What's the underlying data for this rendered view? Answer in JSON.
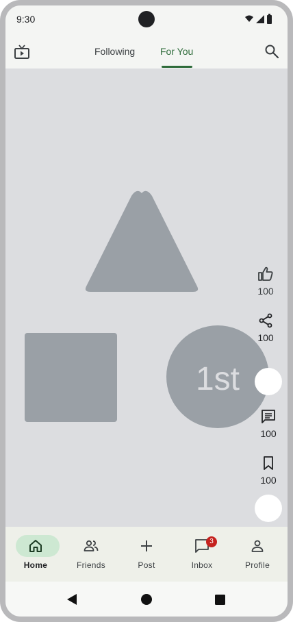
{
  "status": {
    "time": "9:30"
  },
  "topnav": {
    "tabs": [
      {
        "label": "Following",
        "active": false
      },
      {
        "label": "For You",
        "active": true
      }
    ]
  },
  "feed": {
    "overlay_text": "1st",
    "actions": {
      "like_count": "100",
      "share_count": "100",
      "comment_count": "100",
      "save_count": "100"
    }
  },
  "bottomnav": {
    "items": [
      {
        "label": "Home",
        "icon": "home-icon",
        "active": true
      },
      {
        "label": "Friends",
        "icon": "people-icon",
        "active": false
      },
      {
        "label": "Post",
        "icon": "plus-icon",
        "active": false
      },
      {
        "label": "Inbox",
        "icon": "chat-bubble-icon",
        "active": false,
        "badge": "3"
      },
      {
        "label": "Profile",
        "icon": "person-icon",
        "active": false
      }
    ]
  },
  "colors": {
    "accent": "#2e6b3a",
    "active_pill": "#cde8d2",
    "badge": "#c5221f",
    "placeholder_shape": "#9aa0a6",
    "feed_background": "#dcdde0"
  }
}
